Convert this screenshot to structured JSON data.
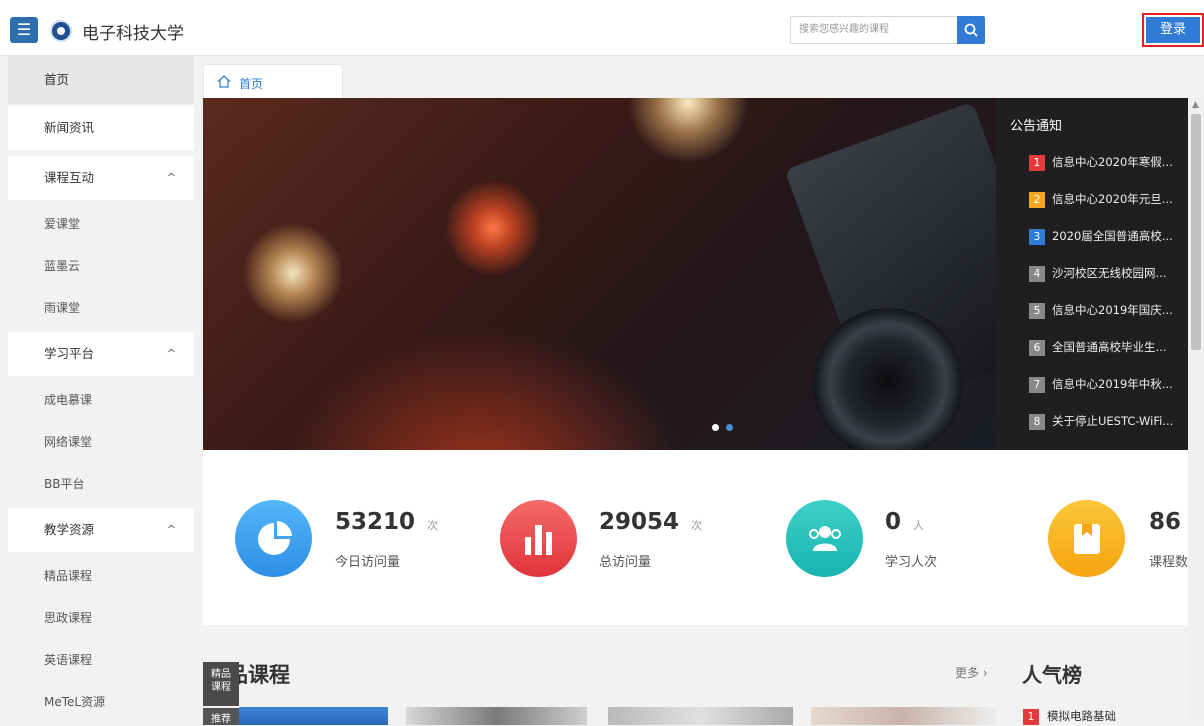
{
  "header": {
    "menu_icon": "menu-icon",
    "brand": "电子科技大学",
    "search_placeholder": "搜索您感兴趣的课程",
    "search_icon": "search-icon",
    "login_label": "登录",
    "accent": "#2f7bd5"
  },
  "sidebar": {
    "items": [
      {
        "label": "首页"
      },
      {
        "label": "新闻资讯"
      },
      {
        "label": "课程互动",
        "chevron": "^"
      },
      {
        "label": "爱课堂"
      },
      {
        "label": "蓝墨云"
      },
      {
        "label": "雨课堂"
      },
      {
        "label": "学习平台",
        "chevron": "^"
      },
      {
        "label": "成电慕课"
      },
      {
        "label": "网络课堂"
      },
      {
        "label": "BB平台"
      },
      {
        "label": "教学资源",
        "chevron": "^"
      },
      {
        "label": "精品课程"
      },
      {
        "label": "思政课程"
      },
      {
        "label": "英语课程"
      },
      {
        "label": "MeTeL资源"
      }
    ]
  },
  "tab": {
    "label": "首页",
    "icon": "home-icon"
  },
  "notices": {
    "title": "公告通知",
    "items": [
      {
        "num": "1",
        "text": "信息中心2020年寒假..."
      },
      {
        "num": "2",
        "text": "信息中心2020年元旦..."
      },
      {
        "num": "3",
        "text": "2020届全国普通高校..."
      },
      {
        "num": "4",
        "text": "沙河校区无线校园网..."
      },
      {
        "num": "5",
        "text": "信息中心2019年国庆..."
      },
      {
        "num": "6",
        "text": "全国普通高校毕业生..."
      },
      {
        "num": "7",
        "text": "信息中心2019年中秋..."
      },
      {
        "num": "8",
        "text": "关于停止UESTC-WiFi..."
      }
    ]
  },
  "stats": [
    {
      "value": "53210",
      "unit": "次",
      "label": "今日访问量",
      "icon": "pie-chart-icon"
    },
    {
      "value": "29054",
      "unit": "次",
      "label": "总访问量",
      "icon": "bar-chart-icon"
    },
    {
      "value": "0",
      "unit": "人",
      "label": "学习人次",
      "icon": "users-icon"
    },
    {
      "value": "86",
      "unit": "",
      "label": "课程数",
      "icon": "book-icon"
    }
  ],
  "courses": {
    "title": "品课程",
    "more": "更多 ›"
  },
  "float_tabs": [
    "精品\n课程",
    "推荐"
  ],
  "ranking": {
    "title": "人气榜",
    "items": [
      {
        "num": "1",
        "text": "模拟电路基础"
      }
    ]
  }
}
